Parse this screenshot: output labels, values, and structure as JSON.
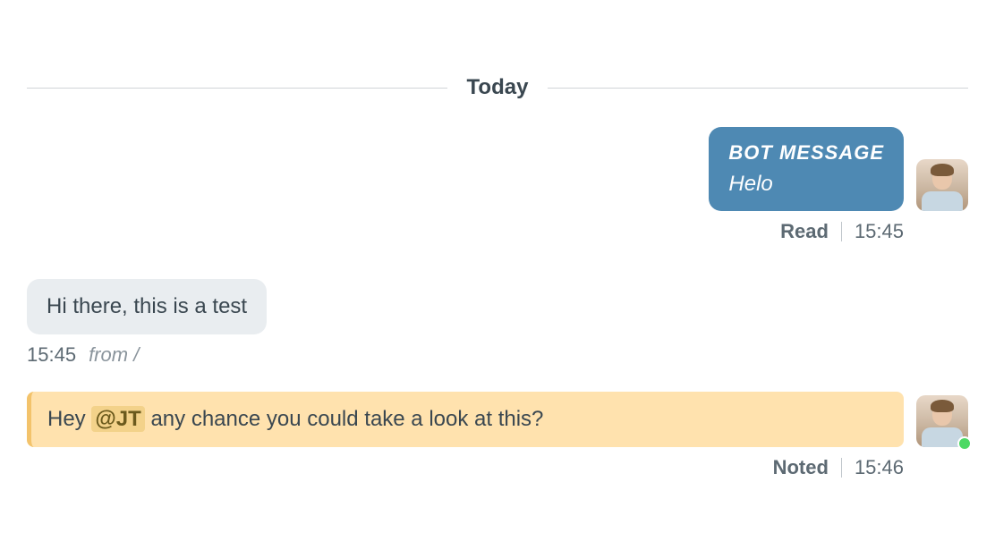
{
  "separator": {
    "label": "Today"
  },
  "messages": [
    {
      "type": "bot-outgoing",
      "bot_label": "BOT MESSAGE",
      "text": "Helo",
      "status": "Read",
      "time": "15:45"
    },
    {
      "type": "incoming",
      "text": "Hi there, this is a test",
      "time": "15:45",
      "source_prefix": "from",
      "source": "/"
    },
    {
      "type": "note",
      "text_before": "Hey ",
      "mention": "@JT",
      "text_after": " any chance you could take a look at this?",
      "status": "Noted",
      "time": "15:46"
    }
  ]
}
